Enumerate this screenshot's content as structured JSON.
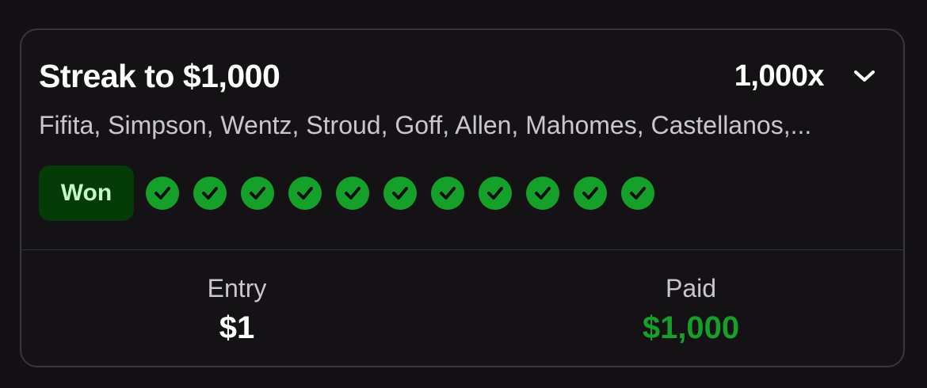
{
  "contest": {
    "title": "Streak to $1,000",
    "multiplier": "1,000x",
    "players": "Fifita, Simpson, Wentz, Stroud, Goff, Allen, Mahomes, Castellanos,...",
    "status": "Won",
    "picks": [
      {
        "result": "correct"
      },
      {
        "result": "correct"
      },
      {
        "result": "correct"
      },
      {
        "result": "correct"
      },
      {
        "result": "correct"
      },
      {
        "result": "correct"
      },
      {
        "result": "correct"
      },
      {
        "result": "correct"
      },
      {
        "result": "correct"
      },
      {
        "result": "correct"
      },
      {
        "result": "correct"
      }
    ]
  },
  "summary": {
    "entry_label": "Entry",
    "entry_value": "$1",
    "paid_label": "Paid",
    "paid_value": "$1,000"
  },
  "colors": {
    "background": "#131114",
    "card_border": "#38363b",
    "won_badge_bg": "#043b07",
    "won_badge_text": "#c9f5cc",
    "check_fill": "#15a02a",
    "paid_value": "#16a02a"
  },
  "icons": {
    "expand": "chevron-down-icon",
    "pick": "check-circle-icon"
  }
}
